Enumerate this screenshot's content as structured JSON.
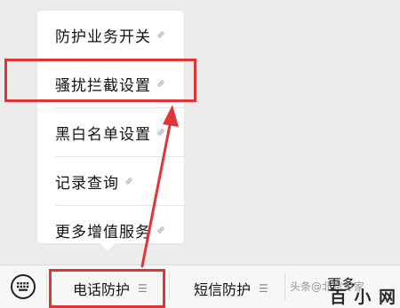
{
  "menu": {
    "items": [
      {
        "label": "防护业务开关",
        "icon": "link-icon"
      },
      {
        "label": "骚扰拦截设置",
        "icon": "link-icon"
      },
      {
        "label": "黑白名单设置",
        "icon": "link-icon"
      },
      {
        "label": "记录查询",
        "icon": "link-icon"
      },
      {
        "label": "更多增值服务",
        "icon": "link-icon"
      }
    ]
  },
  "bottom_bar": {
    "keyboard_icon": "keyboard-icon",
    "tabs": [
      {
        "label": "电话防护",
        "icon": "menu-icon"
      },
      {
        "label": "短信防护",
        "icon": "menu-icon"
      },
      {
        "label": "更多",
        "icon": "menu-icon"
      }
    ]
  },
  "annotations": {
    "highlight_color": "#e03535"
  },
  "watermark": {
    "text": "头条@北京专家",
    "logo": "百 小 网"
  }
}
